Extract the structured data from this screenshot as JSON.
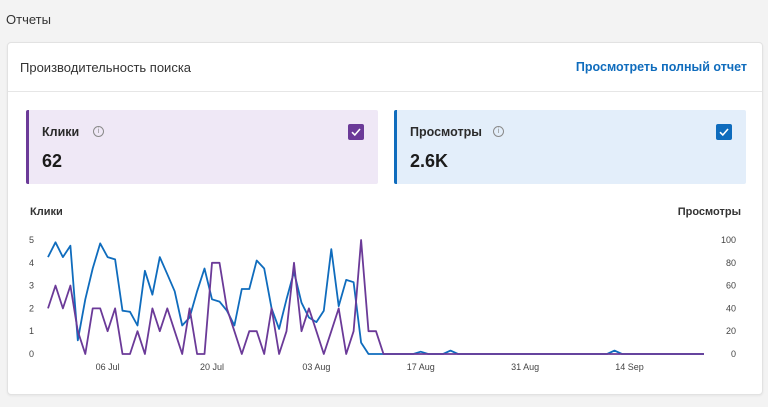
{
  "page": {
    "section_title": "Отчеты"
  },
  "card": {
    "title": "Производительность поиска",
    "link": "Просмотреть полный отчет"
  },
  "metrics": {
    "clicks": {
      "label": "Клики",
      "value": "62",
      "color": "#6b3a98",
      "checked": true
    },
    "impressions": {
      "label": "Просмотры",
      "value": "2.6K",
      "color": "#0f6cbd",
      "checked": true
    }
  },
  "chart_data": {
    "type": "line",
    "left_axis_label": "Клики",
    "right_axis_label": "Просмотры",
    "left_ticks": [
      "0",
      "1",
      "2",
      "3",
      "4",
      "5"
    ],
    "right_ticks": [
      "0",
      "20",
      "40",
      "60",
      "80",
      "100"
    ],
    "x_ticks": [
      {
        "label": "06 Jul",
        "day": 8
      },
      {
        "label": "20 Jul",
        "day": 22
      },
      {
        "label": "03 Aug",
        "day": 36
      },
      {
        "label": "17 Aug",
        "day": 50
      },
      {
        "label": "31 Aug",
        "day": 64
      },
      {
        "label": "14 Sep",
        "day": 78
      }
    ],
    "ylim_left": [
      0,
      5
    ],
    "ylim_right": [
      0,
      100
    ],
    "series": [
      {
        "name": "Просмотры",
        "axis": "right",
        "color": "#0f6cbd",
        "values": [
          85,
          98,
          85,
          95,
          12,
          48,
          75,
          97,
          85,
          83,
          38,
          37,
          25,
          73,
          52,
          85,
          70,
          55,
          25,
          32,
          55,
          75,
          48,
          46,
          38,
          25,
          57,
          57,
          82,
          75,
          40,
          22,
          48,
          72,
          45,
          32,
          28,
          38,
          92,
          42,
          65,
          63,
          10,
          0,
          0,
          0,
          0,
          0,
          0,
          0,
          2,
          0,
          0,
          0,
          3,
          0,
          0,
          0,
          0,
          0,
          0,
          0,
          0,
          0,
          0,
          0,
          0,
          0,
          0,
          0,
          0,
          0,
          0,
          0,
          0,
          0,
          3,
          0,
          0,
          0,
          0,
          0,
          0,
          0,
          0,
          0,
          0,
          0,
          0
        ]
      },
      {
        "name": "Клики",
        "axis": "left",
        "color": "#6b3a98",
        "values": [
          2,
          3,
          2,
          3,
          1,
          0,
          2,
          2,
          1,
          2,
          0,
          0,
          1,
          0,
          2,
          1,
          2,
          1,
          0,
          2,
          0,
          0,
          4,
          4,
          2,
          1,
          0,
          1,
          1,
          0,
          2,
          0,
          1,
          4,
          1,
          2,
          1,
          0,
          1,
          2,
          0,
          1,
          5,
          1,
          1,
          0,
          0,
          0,
          0,
          0,
          0,
          0,
          0,
          0,
          0,
          0,
          0,
          0,
          0,
          0,
          0,
          0,
          0,
          0,
          0,
          0,
          0,
          0,
          0,
          0,
          0,
          0,
          0,
          0,
          0,
          0,
          0,
          0,
          0,
          0,
          0,
          0,
          0,
          0,
          0,
          0,
          0,
          0,
          0
        ]
      }
    ]
  }
}
